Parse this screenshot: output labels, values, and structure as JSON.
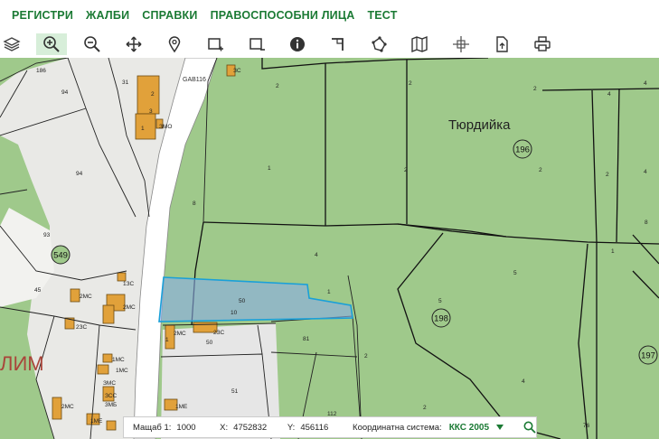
{
  "nav": {
    "items": [
      "РЕГИСТРИ",
      "ЖАЛБИ",
      "СПРАВКИ",
      "ПРАВОСПОСОБНИ ЛИЦА",
      "ТЕСТ"
    ]
  },
  "toolbar": {
    "tools": [
      "layers-icon",
      "zoom-in-icon",
      "zoom-out-icon",
      "pan-icon",
      "location-pin-icon",
      "select-rectangle-icon",
      "select-rectangle-minus-icon",
      "info-icon",
      "measure-corner-icon",
      "draw-polygon-icon",
      "map-book-icon",
      "crosshair-icon",
      "document-upload-icon",
      "print-icon"
    ],
    "active": "zoom-in-icon"
  },
  "colors": {
    "nav_text": "#1b7a34",
    "forest": "#9fc98b",
    "road": "#ffffff",
    "urban": "#ececec",
    "building": "#e1a13a",
    "selection": "#8aaee8",
    "selection_border": "#1aa0d8"
  },
  "map": {
    "place_name": "Тюрдийка",
    "partial_label": "ЛИМ",
    "road_label": "GAB116",
    "circled": [
      "196",
      "549",
      "198",
      "197"
    ],
    "labels": [
      "186",
      "94",
      "31",
      "2",
      "3",
      "1",
      "ЗМО",
      "ЗС",
      "94",
      "8",
      "93",
      "45",
      "2МС",
      "2МС",
      "50",
      "2ЗС",
      "2ЗС",
      "1ЗС",
      "2МС",
      "1МС",
      "1МС",
      "ЗМС",
      "ЗСС",
      "2МС",
      "1МЕ",
      "1МЕ",
      "3МБ",
      "51",
      "4",
      "5",
      "2",
      "1",
      "2",
      "2",
      "4",
      "2",
      "2",
      "4",
      "2",
      "4",
      "81",
      "2",
      "112",
      "2",
      "5",
      "4",
      "8",
      "1",
      "1",
      "76",
      "50",
      "10",
      "1"
    ]
  },
  "status": {
    "scale_label": "Мащаб 1:",
    "scale_value": "1000",
    "x_label": "X:",
    "x_value": "4752832",
    "y_label": "Y:",
    "y_value": "456116",
    "crs_label": "Координатна система:",
    "crs_value": "ККС 2005"
  }
}
